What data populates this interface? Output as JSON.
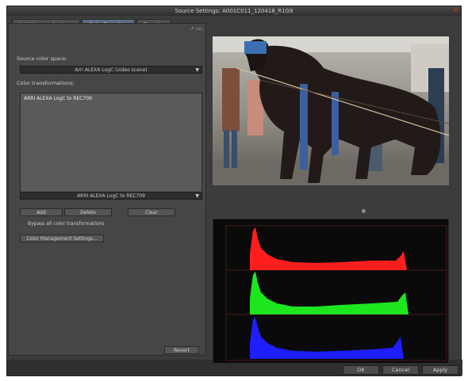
{
  "window": {
    "title": "Source Settings: A001C011_120418_R1G9"
  },
  "tabs": [
    {
      "label": "RAW Source Settings"
    },
    {
      "label": "Color Encoding"
    },
    {
      "label": "Transfer"
    }
  ],
  "panel": {
    "icons_label": "↗ ▫▫"
  },
  "source_color_space": {
    "label": "Source color space:",
    "value": "Arri ALEXA LogC (video scene)"
  },
  "color_transformations": {
    "label": "Color transformations:",
    "items": [
      "ARRI ALEXA LogC to REC709"
    ],
    "selector_value": "ARRI ALEXA LogC to REC709"
  },
  "buttons": {
    "add": "Add",
    "delete": "Delete",
    "clear": "Clear",
    "bypass": "Bypass all color transformations",
    "color_management": "Color Management Settings...",
    "revert": "Revert",
    "ok": "OK",
    "cancel": "Cancel",
    "apply": "Apply"
  },
  "histogram": {
    "channels": [
      {
        "name": "red",
        "color": "#ff1e1e"
      },
      {
        "name": "green",
        "color": "#1ee61e"
      },
      {
        "name": "blue",
        "color": "#1e1eff"
      }
    ]
  }
}
